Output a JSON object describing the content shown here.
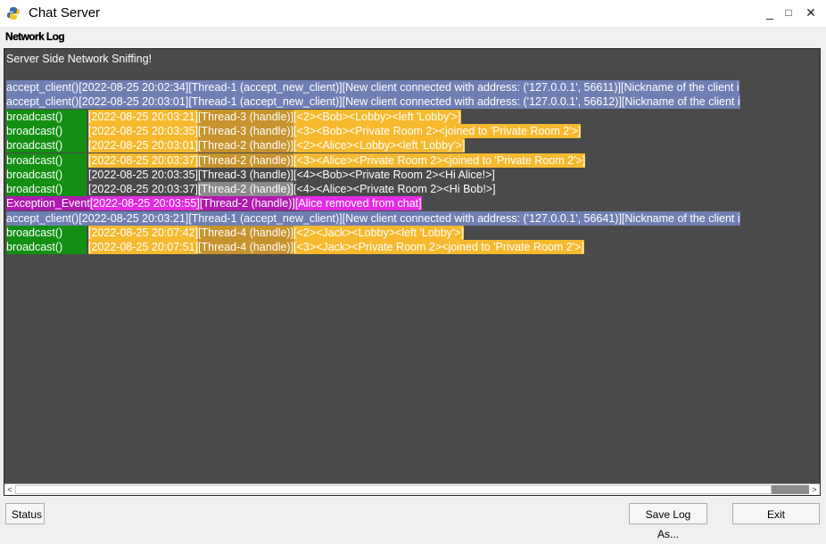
{
  "window": {
    "title": "Chat Server",
    "controls": {
      "minimize": "_",
      "maximize": "□",
      "close": "✕"
    }
  },
  "menu": {
    "label": "Network Log"
  },
  "log": {
    "header": "Server Side Network Sniffing!",
    "lines": [
      {
        "func": "accept_client()",
        "func_bg": "#6f7fb3",
        "time": "[2022-08-25 20:02:34]",
        "time_bg": "#6f7fb3",
        "thread": "[Thread-1 (accept_new_client)]",
        "thread_bg": "#6f7fb3",
        "msg": "[New client connected with address: ('127.0.0.1', 56611)][Nickname of the client i",
        "msg_bg": "#6f7fb3",
        "color": "#ffffff"
      },
      {
        "func": "accept_client()",
        "func_bg": "#6f7fb3",
        "time": "[2022-08-25 20:03:01]",
        "time_bg": "#6f7fb3",
        "thread": "[Thread-1 (accept_new_client)]",
        "thread_bg": "#6f7fb3",
        "msg": "[New client connected with address: ('127.0.0.1', 56612)][Nickname of the client i",
        "msg_bg": "#6f7fb3",
        "color": "#ffffff"
      },
      {
        "func": "broadcast()",
        "func_bg": "#138f13",
        "time": "[2022-08-25 20:03:21]",
        "time_bg": "#f6b92e",
        "thread": "[Thread-3 (handle)]",
        "thread_bg": "#c6932d",
        "msg": "[<2><Bob><Lobby><left 'Lobby'>]",
        "msg_bg": "#f6b92e",
        "color": "#ffffff"
      },
      {
        "func": "broadcast()",
        "func_bg": "#138f13",
        "time": "[2022-08-25 20:03:35]",
        "time_bg": "#f6b92e",
        "thread": "[Thread-3 (handle)]",
        "thread_bg": "#c6932d",
        "msg": "[<3><Bob><Private Room 2><joined to 'Private Room 2'>]",
        "msg_bg": "#f6b92e",
        "color": "#ffffff"
      },
      {
        "func": "broadcast()",
        "func_bg": "#138f13",
        "time": "[2022-08-25 20:03:01]",
        "time_bg": "#f6b92e",
        "thread": "[Thread-2 (handle)]",
        "thread_bg": "#c6932d",
        "msg": "[<2><Alice><Lobby><left 'Lobby'>]",
        "msg_bg": "#f6b92e",
        "color": "#ffffff"
      },
      {
        "func": "broadcast()",
        "func_bg": "#138f13",
        "time": "[2022-08-25 20:03:37]",
        "time_bg": "#f6b92e",
        "thread": "[Thread-2 (handle)]",
        "thread_bg": "#c6932d",
        "msg": "[<3><Alice><Private Room 2><joined to 'Private Room 2'>]",
        "msg_bg": "#f6b92e",
        "color": "#ffffff"
      },
      {
        "func": "broadcast()",
        "func_bg": "#138f13",
        "time": "[2022-08-25 20:03:35]",
        "time_bg": "#4a4a4a",
        "thread": "[Thread-3 (handle)]",
        "thread_bg": "#4a4a4a",
        "msg": "[<4><Bob><Private Room 2><Hi Alice!>]",
        "msg_bg": "#4a4a4a",
        "color": "#ffffff"
      },
      {
        "func": "broadcast()",
        "func_bg": "#138f13",
        "time": "[2022-08-25 20:03:37]",
        "time_bg": "#4a4a4a",
        "thread": "[Thread-2 (handle)]",
        "thread_bg": "#8a8a8a",
        "msg": "[<4><Alice><Private Room 2><Hi Bob!>]",
        "msg_bg": "#4a4a4a",
        "color": "#ffffff"
      },
      {
        "func": "Exception_Event ",
        "func_bg": "#b01ab0",
        "time": "[2022-08-25 20:03:55]",
        "time_bg": "#e32be3",
        "thread": "[Thread-2 (handle)]",
        "thread_bg": "#b01ab0",
        "msg": "[Alice removed from chat]",
        "msg_bg": "#e32be3",
        "color": "#ffffff"
      },
      {
        "func": "accept_client()",
        "func_bg": "#6f7fb3",
        "time": "[2022-08-25 20:03:21]",
        "time_bg": "#6f7fb3",
        "thread": "[Thread-1 (accept_new_client)]",
        "thread_bg": "#6f7fb3",
        "msg": "[New client connected with address: ('127.0.0.1', 56641)][Nickname of the client i",
        "msg_bg": "#6f7fb3",
        "color": "#ffffff"
      },
      {
        "func": "broadcast()",
        "func_bg": "#138f13",
        "time": "[2022-08-25 20:07:42]",
        "time_bg": "#f6b92e",
        "thread": "[Thread-4 (handle)]",
        "thread_bg": "#c6932d",
        "msg": "[<2><Jack><Lobby><left 'Lobby'>]",
        "msg_bg": "#f6b92e",
        "color": "#ffffff"
      },
      {
        "func": "broadcast()",
        "func_bg": "#138f13",
        "time": "[2022-08-25 20:07:51]",
        "time_bg": "#f6b92e",
        "thread": "[Thread-4 (handle)]",
        "thread_bg": "#c6932d",
        "msg": "[<3><Jack><Private Room 2><joined to 'Private Room 2'>]",
        "msg_bg": "#f6b92e",
        "color": "#ffffff"
      }
    ]
  },
  "scrollbar": {
    "left_arrow": "<",
    "right_arrow": ">"
  },
  "buttons": {
    "status": "Status",
    "save_log": "Save Log As...",
    "exit": "Exit"
  }
}
